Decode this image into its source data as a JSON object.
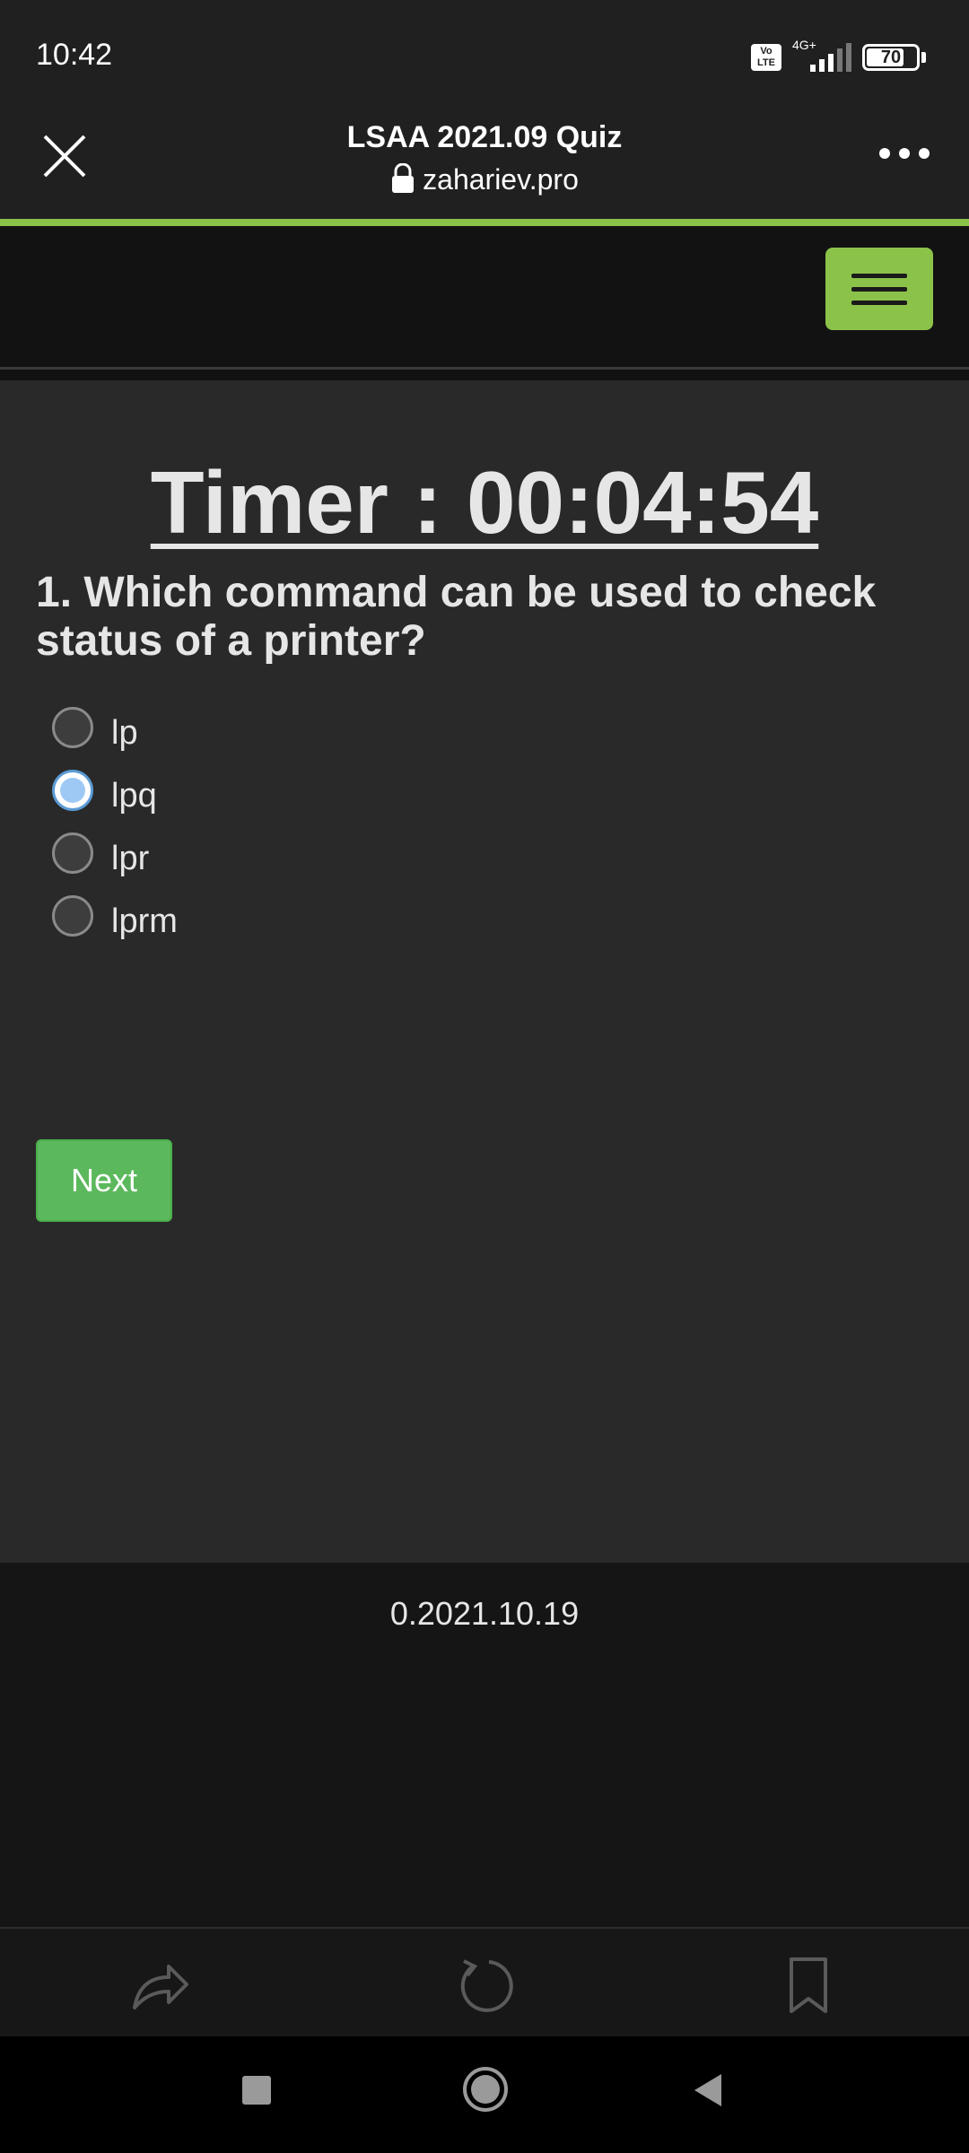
{
  "status_bar": {
    "time": "10:42",
    "volte_label": "Vo LTE",
    "network_label": "4G+",
    "battery_level": "70"
  },
  "browser": {
    "title": "LSAA 2021.09 Quiz",
    "url": "zahariev.pro",
    "icons": [
      "close-icon",
      "lock-icon",
      "more-icon"
    ],
    "accent_color": "#8bc34a"
  },
  "quiz": {
    "timer": "Timer : 00:04:54",
    "question": "1. Which command can be used to check status of a printer?",
    "options": [
      {
        "label": "lp",
        "selected": false
      },
      {
        "label": "lpq",
        "selected": true
      },
      {
        "label": "lpr",
        "selected": false
      },
      {
        "label": "lprm",
        "selected": false
      }
    ],
    "next_label": "Next",
    "button_color": "#5cb85c"
  },
  "footer": {
    "version": "0.2021.10.19"
  },
  "bottom_bar": {
    "icons": [
      "share-icon",
      "reload-icon",
      "bookmark-icon"
    ]
  },
  "system_nav": {
    "icons": [
      "recents-icon",
      "home-icon",
      "back-icon"
    ]
  }
}
